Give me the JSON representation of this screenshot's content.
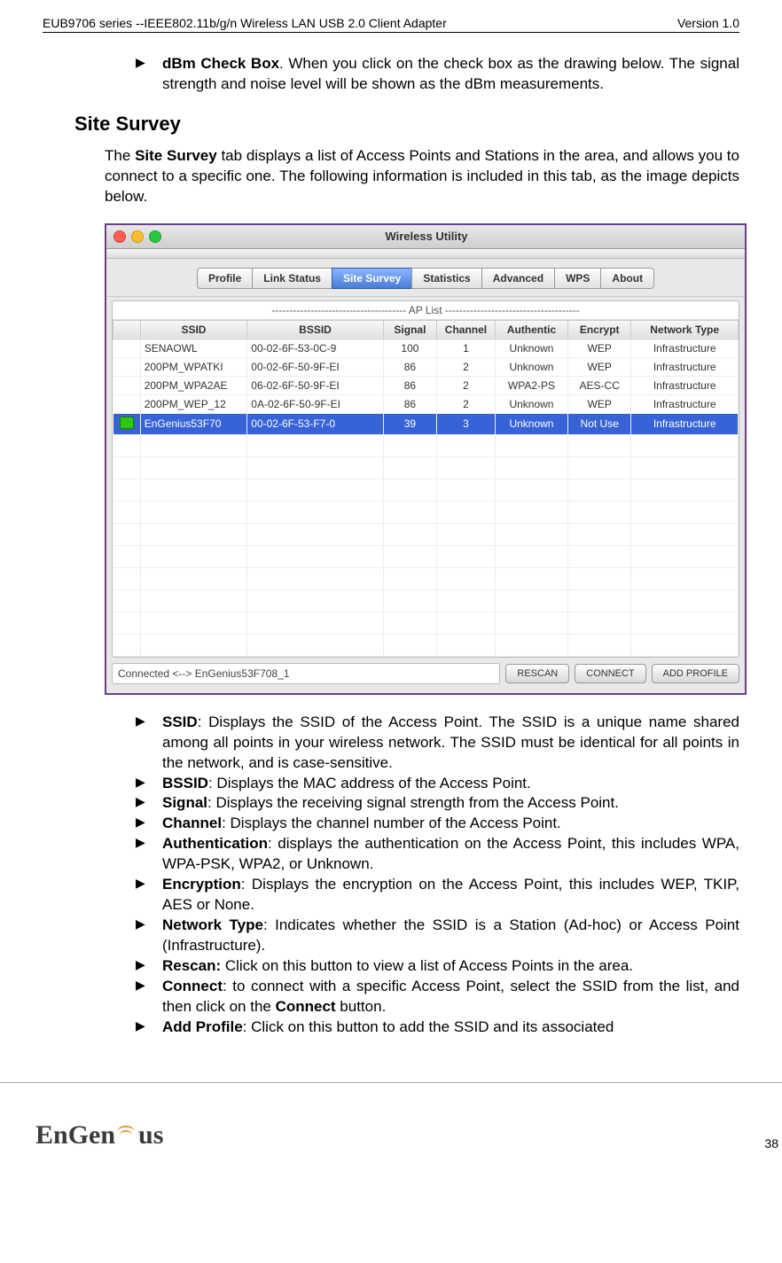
{
  "header": {
    "left": "EUB9706 series --IEEE802.11b/g/n Wireless LAN USB 2.0 Client Adapter",
    "right": "Version 1.0"
  },
  "top_bullet": {
    "label": "dBm Check Box",
    "text": ". When you click on the check box as the drawing below. The signal strength and noise level will be shown as the dBm measurements."
  },
  "section_title": "Site Survey",
  "intro_pre": "The ",
  "intro_bold": "Site Survey",
  "intro_post": " tab displays a list of Access Points and Stations in the area, and allows you to connect to a specific one.  The following information is included in this tab, as the image depicts below.",
  "window": {
    "title": "Wireless Utility",
    "tabs": [
      "Profile",
      "Link Status",
      "Site Survey",
      "Statistics",
      "Advanced",
      "WPS",
      "About"
    ],
    "active_tab": 2,
    "ap_list_title": "-------------------------------------- AP List --------------------------------------",
    "columns": [
      "",
      "SSID",
      "BSSID",
      "Signal",
      "Channel",
      "Authentic",
      "Encrypt",
      "Network Type"
    ],
    "rows": [
      {
        "icon": "",
        "ssid": "SENAOWL",
        "bssid": "00-02-6F-53-0C-9",
        "signal": "100",
        "channel": "1",
        "auth": "Unknown",
        "enc": "WEP",
        "net": "Infrastructure",
        "sel": false
      },
      {
        "icon": "",
        "ssid": "200PM_WPATKI",
        "bssid": "00-02-6F-50-9F-EI",
        "signal": "86",
        "channel": "2",
        "auth": "Unknown",
        "enc": "WEP",
        "net": "Infrastructure",
        "sel": false
      },
      {
        "icon": "",
        "ssid": "200PM_WPA2AE",
        "bssid": "06-02-6F-50-9F-EI",
        "signal": "86",
        "channel": "2",
        "auth": "WPA2-PS",
        "enc": "AES-CC",
        "net": "Infrastructure",
        "sel": false
      },
      {
        "icon": "",
        "ssid": "200PM_WEP_12",
        "bssid": "0A-02-6F-50-9F-EI",
        "signal": "86",
        "channel": "2",
        "auth": "Unknown",
        "enc": "WEP",
        "net": "Infrastructure",
        "sel": false
      },
      {
        "icon": "bug",
        "ssid": "EnGenius53F70",
        "bssid": "00-02-6F-53-F7-0",
        "signal": "39",
        "channel": "3",
        "auth": "Unknown",
        "enc": "Not Use",
        "net": "Infrastructure",
        "sel": true
      }
    ],
    "empty_rows": 10,
    "status": "Connected <--> EnGenius53F708_1",
    "buttons": [
      "RESCAN",
      "CONNECT",
      "ADD PROFILE"
    ]
  },
  "bullets": [
    {
      "label": "SSID",
      "text": ": Displays the SSID of the Access Point. The SSID is a unique name shared among all points in your wireless network. The SSID must be identical for all points in the network, and is case-sensitive."
    },
    {
      "label": "BSSID",
      "text": ": Displays the MAC address of the Access Point."
    },
    {
      "label": "Signal",
      "text": ": Displays the receiving signal strength from the Access Point."
    },
    {
      "label": "Channel",
      "text": ": Displays the channel number of the Access Point."
    },
    {
      "label": "Authentication",
      "text": ": displays the authentication on the Access Point, this includes WPA, WPA-PSK, WPA2, or Unknown."
    },
    {
      "label": "Encryption",
      "text": ": Displays the encryption on the Access Point, this includes WEP, TKIP, AES or None."
    },
    {
      "label": "Network Type",
      "text": ": Indicates whether the SSID is a Station (Ad-hoc) or Access Point (Infrastructure)."
    },
    {
      "label": "Rescan:",
      "text": " Click on this button to view a list of Access Points in the area."
    },
    {
      "label": "Connect",
      "text": ": to connect with a specific Access Point, select the SSID from the list, and then click on the ",
      "bold2": "Connect",
      "text2": " button."
    },
    {
      "label": "Add Profile",
      "text": ": Click on this button to add the SSID and its associated"
    }
  ],
  "footer": {
    "logo_pre": "EnGen",
    "logo_post": "us",
    "page": "38"
  }
}
